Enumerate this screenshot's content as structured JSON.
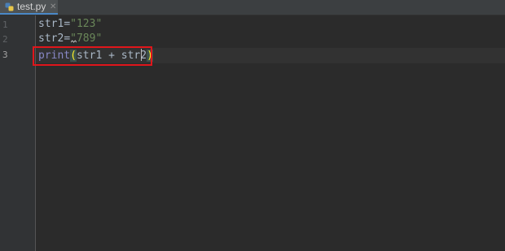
{
  "tab": {
    "filename": "test.py",
    "close_glyph": "✕",
    "icon": "python-file-icon"
  },
  "gutter": {
    "line_numbers": [
      "1",
      "2",
      "3"
    ]
  },
  "code": {
    "line1": {
      "ident": "str1",
      "op": "=",
      "string": "\"123\""
    },
    "line2": {
      "ident": "str2",
      "op": "=",
      "string": "\"789\""
    },
    "line3": {
      "builtin": "print",
      "open_paren": "(",
      "args": "str1 + str2",
      "close_paren": ")"
    }
  },
  "colors": {
    "editor_bg": "#2b2b2b",
    "string": "#6a8759",
    "builtin": "#8888c6",
    "highlight_box": "#e0161b"
  }
}
